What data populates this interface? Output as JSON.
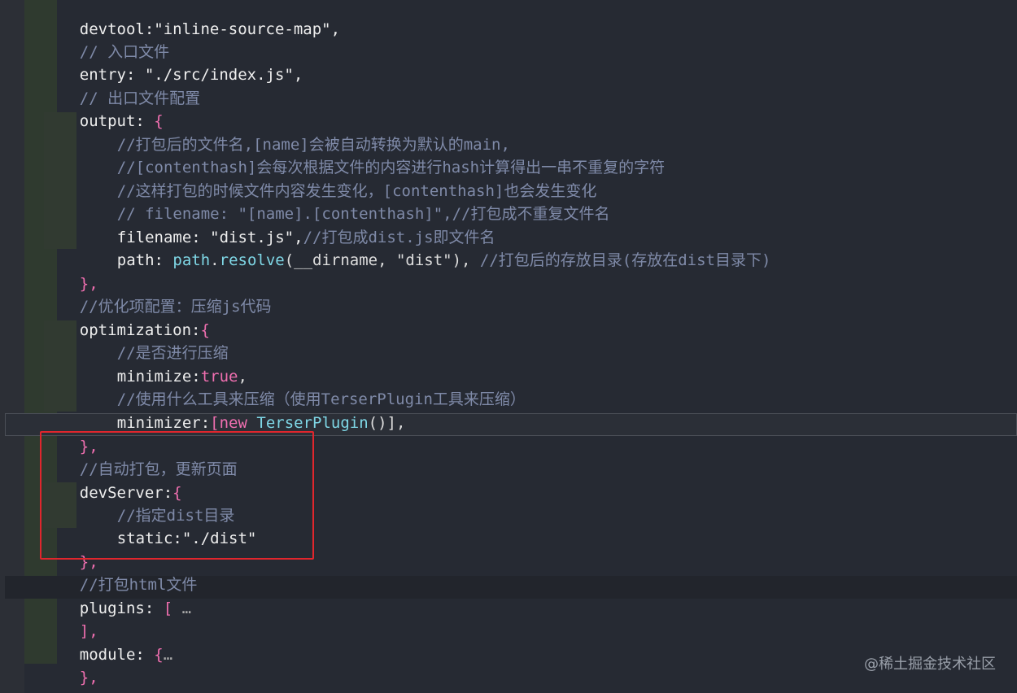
{
  "lines": {
    "devtool_key": "devtool:",
    "devtool_value": "\"inline-source-map\",",
    "c_entry": "// 入口文件",
    "entry_key": "entry:",
    "entry_value": " \"./src/index.js\",",
    "c_output": "// 出口文件配置",
    "output_key": "output:",
    "output_brace": " {",
    "c_out1": "//打包后的文件名,[name]会被自动转换为默认的main,",
    "c_out2": "//[contenthash]会每次根据文件的内容进行hash计算得出一串不重复的字符",
    "c_out3": "//这样打包的时候文件内容发生变化，[contenthash]也会发生变化",
    "c_out4": "// filename: \"[name].[contenthash]\",//打包成不重复文件名",
    "filename_key": "filename:",
    "filename_value": " \"dist.js\",",
    "filename_comment": "//打包成dist.js即文件名",
    "path_key": "path:",
    "path_obj": " path",
    "path_dot": ".",
    "path_func": "resolve",
    "path_args": "(__dirname, \"dist\"),",
    "path_comment": " //打包后的存放目录(存放在dist目录下)",
    "output_close": "},",
    "c_opt": "//优化项配置：压缩js代码",
    "opt_key": "optimization:",
    "opt_brace": "{",
    "c_min": "//是否进行压缩",
    "min_key": "minimize:",
    "min_value": "true",
    "min_comma": ",",
    "c_minr": "//使用什么工具来压缩（使用TerserPlugin工具来压缩）",
    "minr_key": "minimizer:",
    "minr_open": "[",
    "minr_new": "new",
    "minr_cls": " TerserPlugin",
    "minr_close": "()],",
    "opt_close": "},",
    "c_dev": "//自动打包，更新页面",
    "dev_key": "devServer:",
    "dev_brace": "{",
    "c_static": "//指定dist目录",
    "static_key": "static:",
    "static_value": "\"./dist\"",
    "dev_close": "},",
    "c_html": "//打包html文件",
    "plugins_key": "plugins:",
    "plugins_open": " [",
    "plugins_fold": " …",
    "plugins_close": "],",
    "module_key": "module:",
    "module_open": " {",
    "module_fold": "…",
    "module_close": "},",
    "outer_close": "}"
  },
  "watermark": "@稀土掘金技术社区",
  "colors": {
    "background": "#262a33",
    "comment": "#7f8aa8",
    "punctuation": "#f06fb0",
    "function": "#7fd7e6",
    "highlight_border": "#e0262d"
  }
}
